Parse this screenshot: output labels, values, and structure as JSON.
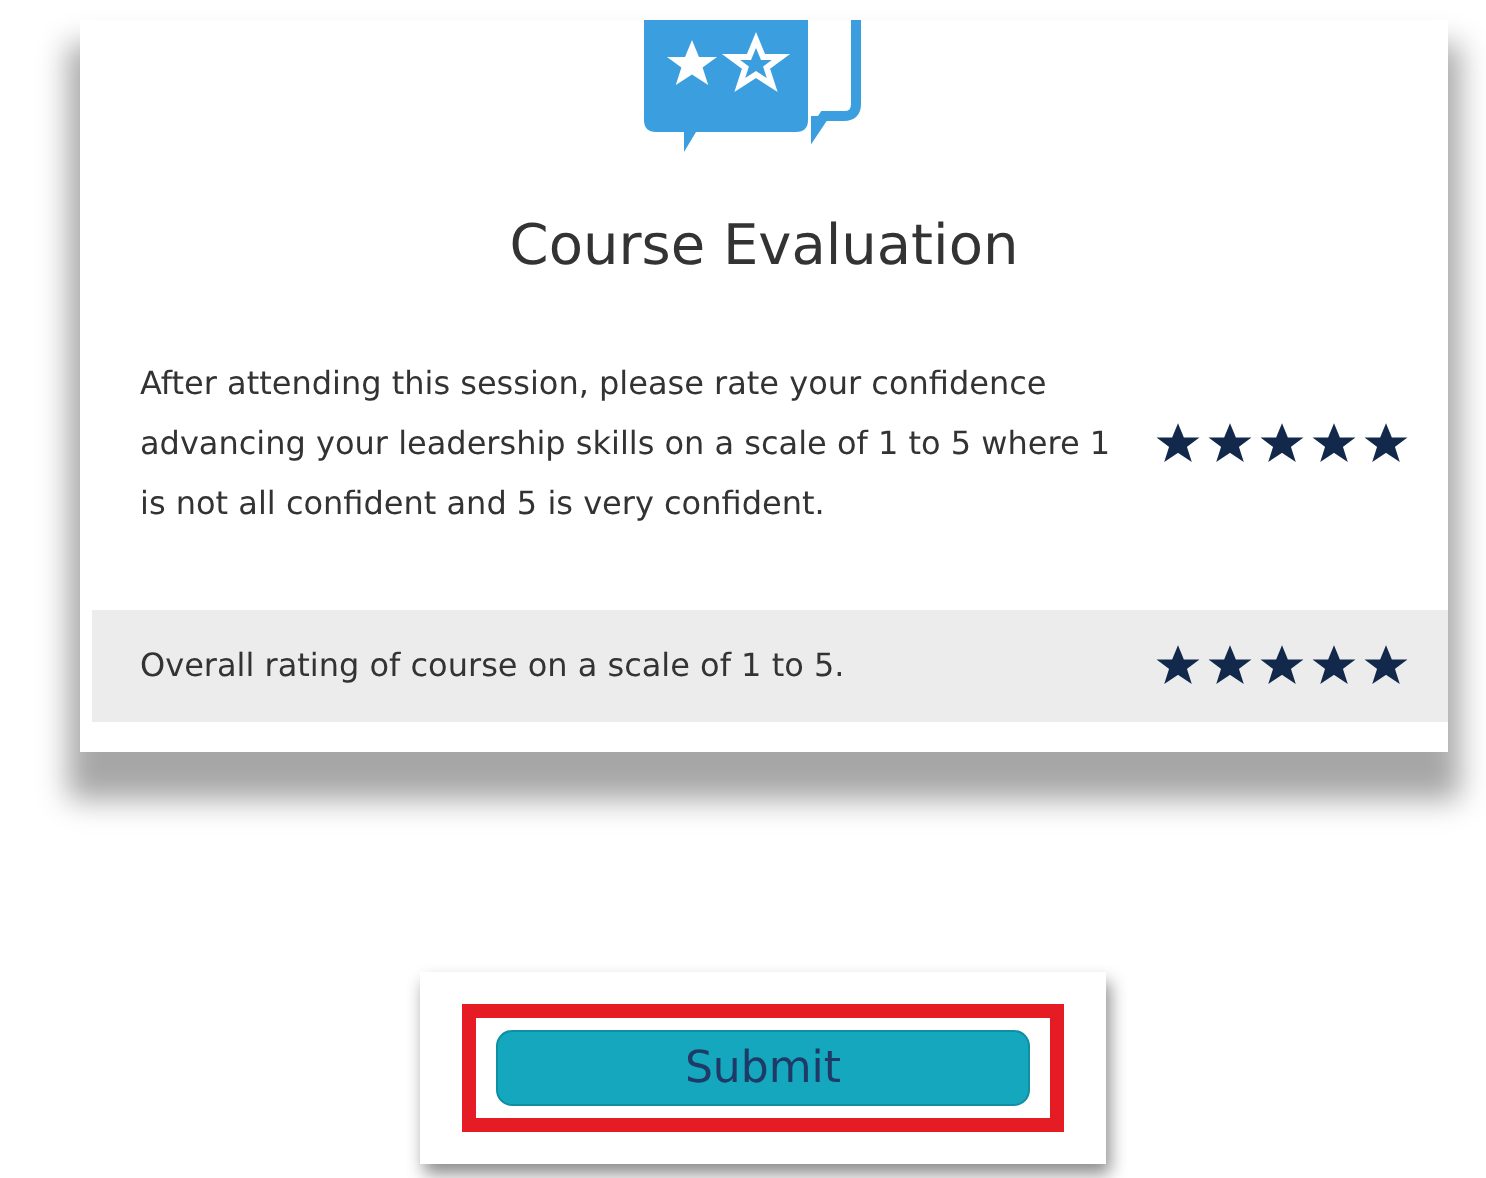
{
  "title": "Course Evaluation",
  "questions": [
    {
      "text": "After attending this session, please rate your confidence advancing your leadership skills on a scale of 1 to 5 where 1 is not all confident and 5 is very confident.",
      "stars": 5,
      "shaded": false
    },
    {
      "text": "Overall rating of course on a scale of 1 to 5.",
      "stars": 5,
      "shaded": true
    }
  ],
  "submit": {
    "label": "Submit",
    "highlighted": true
  }
}
